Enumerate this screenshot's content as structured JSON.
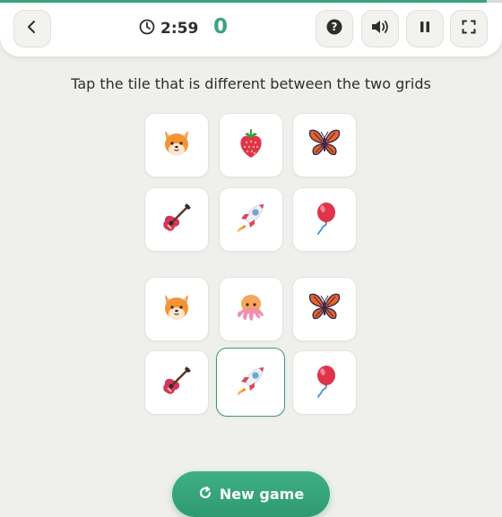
{
  "progress_fraction": 0.97,
  "header": {
    "timer": "2:59",
    "score": "0"
  },
  "instruction": "Tap the tile that is different between the two grids",
  "grid_top": [
    {
      "icon": "fox-face-icon"
    },
    {
      "icon": "strawberry-icon"
    },
    {
      "icon": "butterfly-icon"
    },
    {
      "icon": "guitar-icon"
    },
    {
      "icon": "rocket-icon"
    },
    {
      "icon": "balloon-icon"
    }
  ],
  "grid_bottom": [
    {
      "icon": "fox-face-icon"
    },
    {
      "icon": "octopus-icon"
    },
    {
      "icon": "butterfly-icon"
    },
    {
      "icon": "guitar-icon"
    },
    {
      "icon": "rocket-icon",
      "selected": true
    },
    {
      "icon": "balloon-icon"
    }
  ],
  "new_game_label": "New game",
  "colors": {
    "accent": "#3aa57f",
    "background": "#efefec",
    "tile": "#ffffff"
  }
}
